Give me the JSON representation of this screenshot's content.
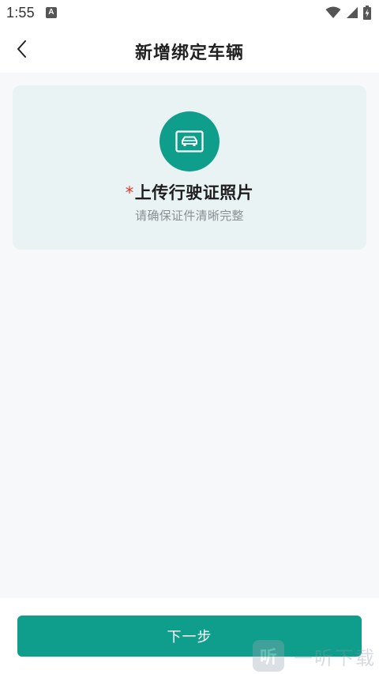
{
  "status_bar": {
    "time": "1:55",
    "notification_badge": "A",
    "icons": [
      "wifi-icon",
      "signal-icon",
      "battery-charging-icon"
    ]
  },
  "header": {
    "title": "新增绑定车辆",
    "back_icon": "chevron-left-icon"
  },
  "upload_card": {
    "icon": "car-license-icon",
    "required_mark": "*",
    "title": "上传行驶证照片",
    "subtitle": "请确保证件清晰完整"
  },
  "footer": {
    "next_label": "下一步"
  },
  "watermark": {
    "logo_char": "听",
    "text": "一听下载"
  },
  "colors": {
    "accent": "#0f9e8b",
    "card_background": "#eaf3f4",
    "page_background": "#f6f8f9",
    "required": "#e0342c",
    "subtitle": "#8a8f94"
  }
}
